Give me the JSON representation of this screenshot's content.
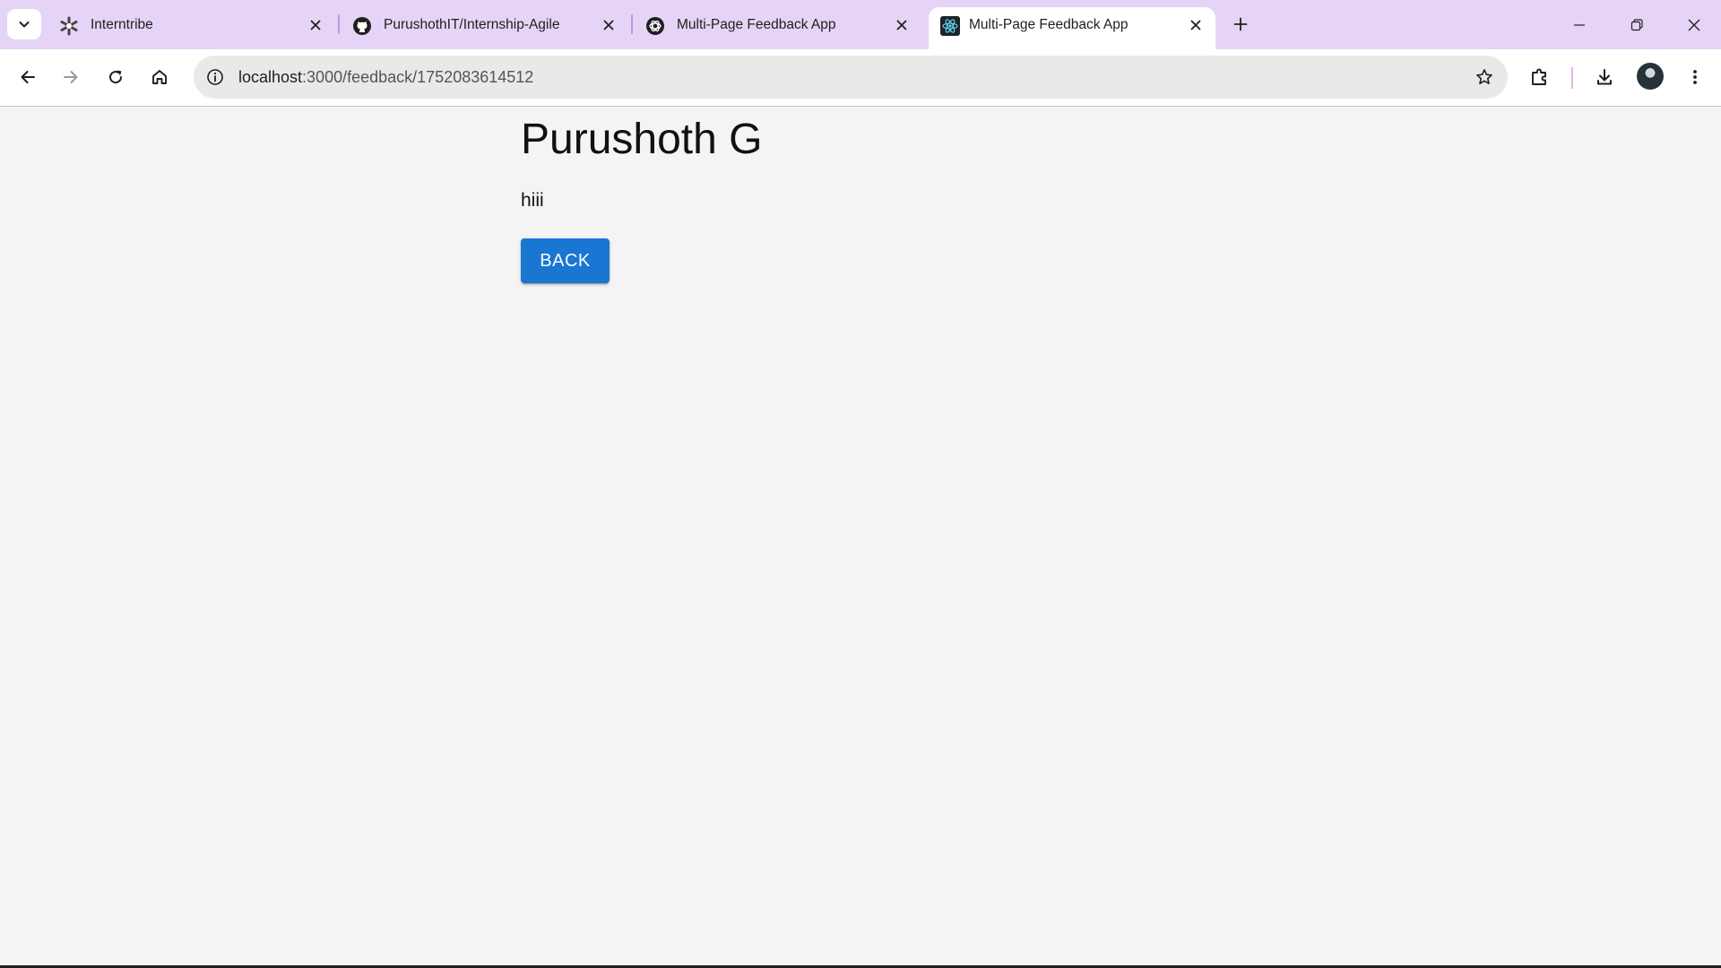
{
  "browser": {
    "tabs": [
      {
        "title": "Interntribe",
        "icon": "interntribe-logo-icon",
        "active": false
      },
      {
        "title": "PurushothIT/Internship-Agile",
        "icon": "github-icon",
        "active": false
      },
      {
        "title": "Multi-Page Feedback App",
        "icon": "openai-icon",
        "active": false
      },
      {
        "title": "Multi-Page Feedback App",
        "icon": "react-icon",
        "active": true
      }
    ],
    "address": {
      "host": "localhost",
      "path": ":3000/feedback/1752083614512"
    },
    "colors": {
      "tabstrip": "#e5d4f5",
      "toolbar": "#ffffff",
      "omnibox": "#e9e9e9"
    }
  },
  "page": {
    "title": "Purushoth G",
    "feedback": "hiii",
    "back_label": "BACK",
    "colors": {
      "background": "#f4f4f4",
      "button": "#1976d2",
      "button_text": "#ffffff"
    }
  }
}
